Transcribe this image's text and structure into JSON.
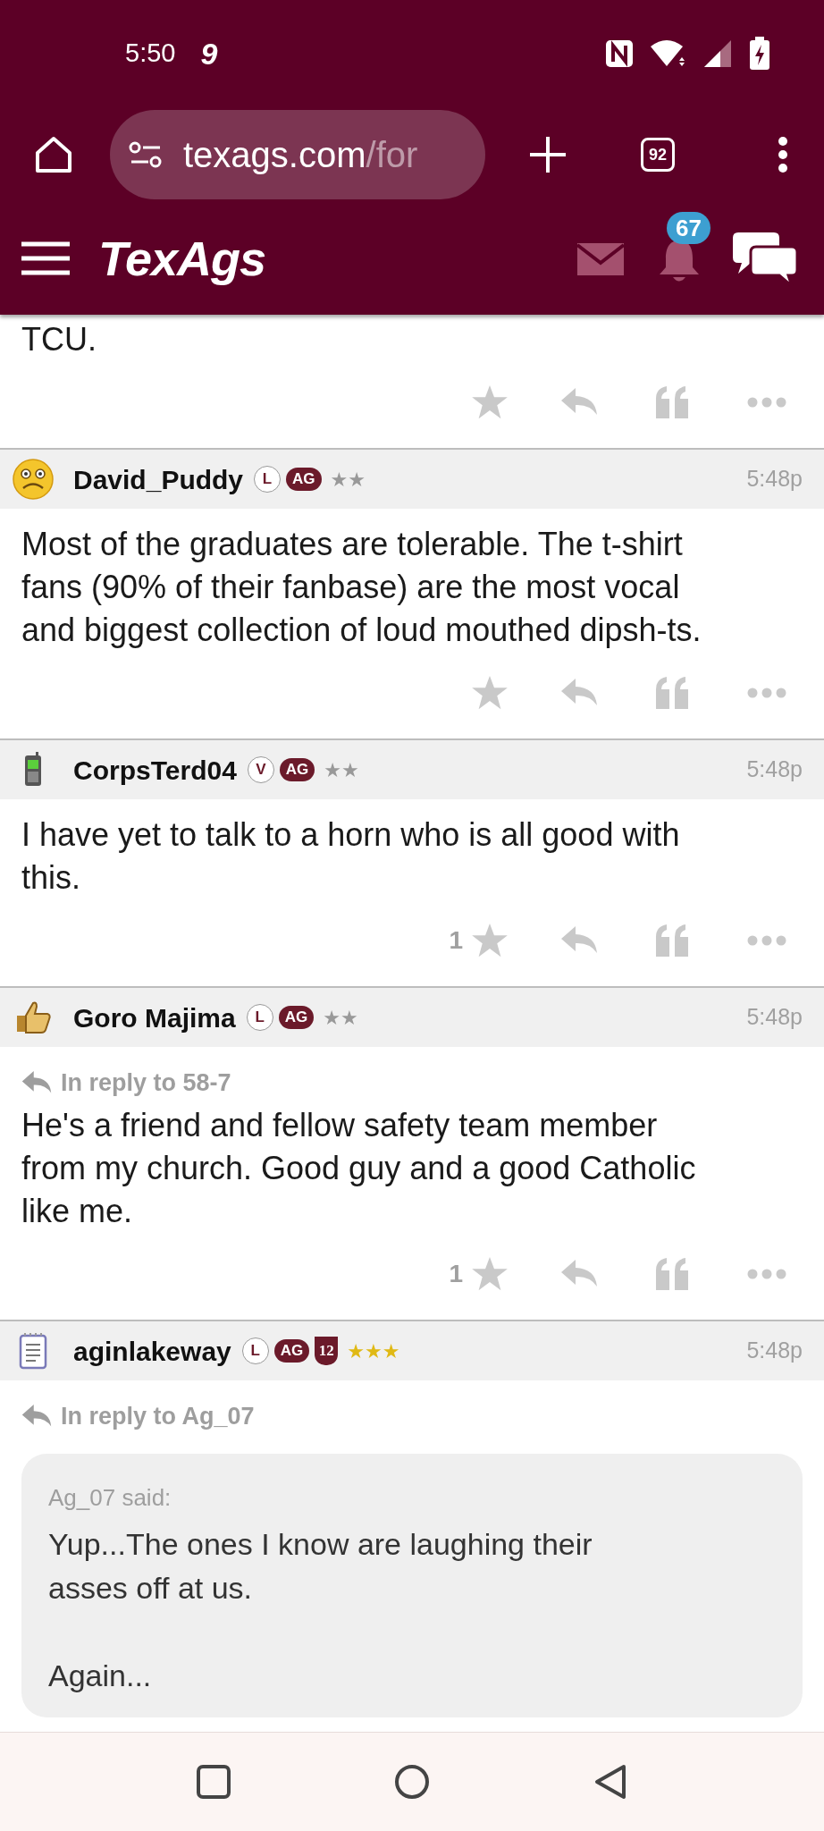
{
  "status_bar": {
    "time": "5:50",
    "notification_glyph": "9"
  },
  "browser": {
    "url_host": "texags.com",
    "url_path": "/for",
    "tab_count": "92"
  },
  "site_header": {
    "logo": "TexAgs",
    "notification_count": "67"
  },
  "posts": [
    {
      "body": "TCU."
    },
    {
      "author": "David_Puddy",
      "avatar": {
        "kind": "face"
      },
      "badges": [
        {
          "kind": "circle",
          "text": "L"
        },
        {
          "kind": "pill",
          "text": "AG"
        }
      ],
      "rank": {
        "text": "★★",
        "color": "#999999"
      },
      "time": "5:48p",
      "body": "Most of the graduates are tolerable. The t-shirt fans (90% of their fanbase) are the most vocal and biggest collection of loud mouthed dipsh-ts."
    },
    {
      "author": "CorpsTerd04",
      "avatar": {
        "kind": "phone"
      },
      "badges": [
        {
          "kind": "circle",
          "text": "V"
        },
        {
          "kind": "pill",
          "text": "AG"
        }
      ],
      "rank": {
        "text": "★★",
        "color": "#999999"
      },
      "time": "5:48p",
      "body": "I have yet to talk to a horn who is all good with this.",
      "like_count": "1"
    },
    {
      "author": "Goro Majima",
      "avatar": {
        "kind": "thumb"
      },
      "badges": [
        {
          "kind": "circle",
          "text": "L"
        },
        {
          "kind": "pill",
          "text": "AG"
        }
      ],
      "rank": {
        "text": "★★",
        "color": "#999999"
      },
      "time": "5:48p",
      "reply_to": "In reply to 58-7",
      "body": "He's a friend and fellow safety team member from my church. Good guy and a good Catholic like me.",
      "like_count": "1"
    },
    {
      "author": "aginlakeway",
      "avatar": {
        "kind": "notepad"
      },
      "badges": [
        {
          "kind": "circle",
          "text": "L"
        },
        {
          "kind": "pill",
          "text": "AG"
        },
        {
          "kind": "shield",
          "text": "12"
        }
      ],
      "rank": {
        "text": "★★★",
        "color": "#e0b915"
      },
      "time": "5:48p",
      "reply_to": "In reply to Ag_07",
      "quote": {
        "attribution": "Ag_07 said:",
        "text": "Yup...The ones I know are laughing their asses off at us.\n\nAgain..."
      }
    }
  ]
}
